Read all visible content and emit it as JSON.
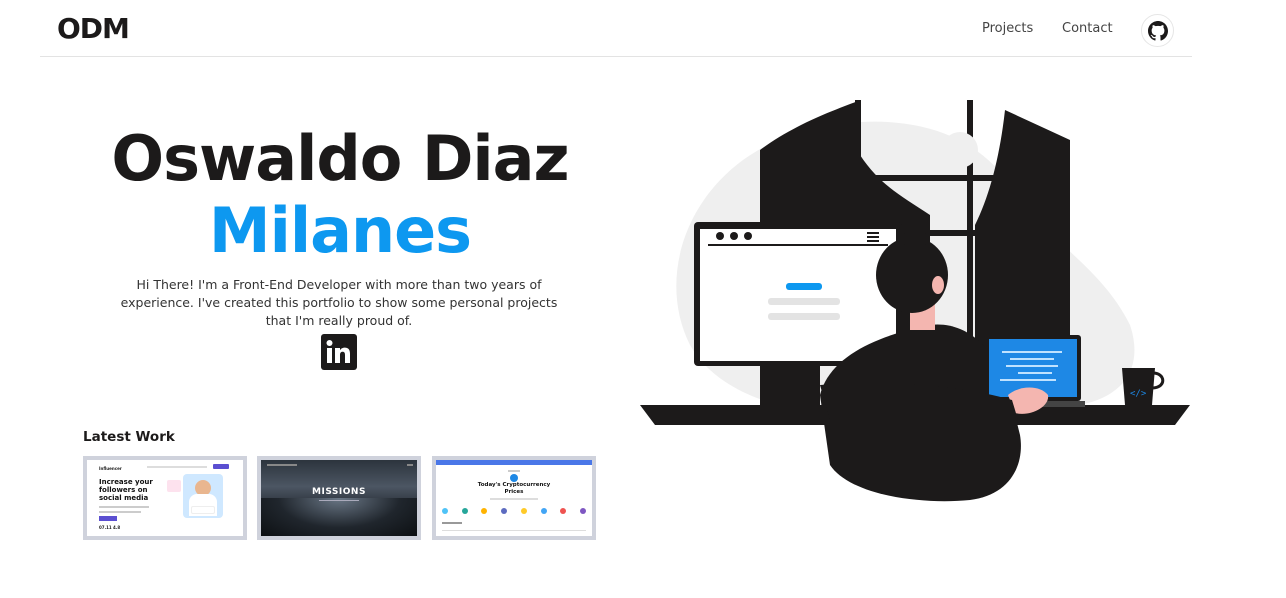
{
  "header": {
    "logo": "ODM",
    "nav": [
      {
        "label": "Projects"
      },
      {
        "label": "Contact"
      }
    ],
    "github_icon": "github-icon"
  },
  "hero": {
    "name_line1": "Oswaldo Diaz",
    "name_line2": "Milanes",
    "bio": "Hi There! I'm a Front-End Developer with more than two years of experience. I've created this portfolio to show some personal projects that I'm really proud of.",
    "linkedin_icon": "linkedin-icon",
    "accent_color": "#0d98f0"
  },
  "latest_work": {
    "title": "Latest Work",
    "projects": [
      {
        "brand": "Influencer",
        "heading": "Increase your followers on social media",
        "stat": "07.11 4.8"
      },
      {
        "heading": "MISSIONS"
      },
      {
        "heading": "Today's Cryptocurrency Prices"
      }
    ]
  }
}
